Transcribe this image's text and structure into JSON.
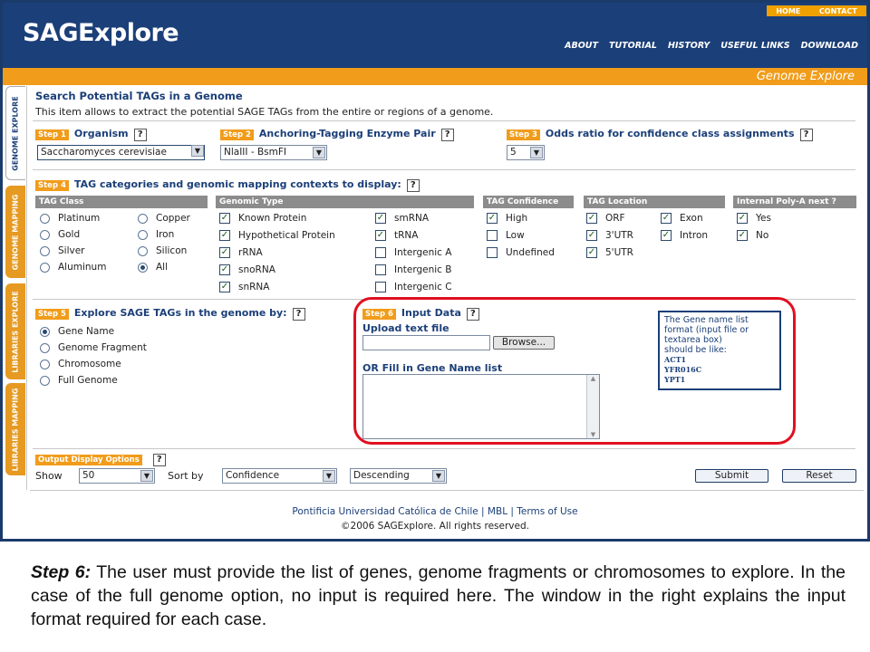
{
  "header": {
    "logo": "SAGExplore",
    "home": "HOME",
    "contact": "CONTACT",
    "nav": [
      "ABOUT",
      "TUTORIAL",
      "HISTORY",
      "USEFUL LINKS",
      "DOWNLOAD"
    ],
    "section": "Genome Explore"
  },
  "sidetabs": [
    "GENOME EXPLORE",
    "GENOME MAPPING",
    "LIBRARIES EXPLORE",
    "LIBRARIES MAPPING"
  ],
  "page": {
    "title": "Search Potential TAGs in a Genome",
    "intro": "This item allows to extract the potential SAGE TAGs from the entire or regions of a genome."
  },
  "step1": {
    "tag": "Step 1",
    "label": "Organism",
    "value": "Saccharomyces cerevisiae"
  },
  "step2": {
    "tag": "Step 2",
    "label": "Anchoring-Tagging Enzyme Pair",
    "value": "NlaIII - BsmFI"
  },
  "step3": {
    "tag": "Step 3",
    "label": "Odds ratio for confidence class assignments",
    "value": "5"
  },
  "help": "?",
  "step4": {
    "tag": "Step 4",
    "label": "TAG categories and genomic mapping contexts to display:",
    "tagclass": {
      "header": "TAG Class",
      "col1": [
        "Platinum",
        "Gold",
        "Silver",
        "Aluminum"
      ],
      "col2": [
        "Copper",
        "Iron",
        "Silicon",
        "All"
      ]
    },
    "genomic": {
      "header": "Genomic Type",
      "col1": [
        "Known Protein",
        "Hypothetical Protein",
        "rRNA",
        "snoRNA",
        "snRNA"
      ],
      "col2": [
        "smRNA",
        "tRNA",
        "Intergenic A",
        "Intergenic B",
        "Intergenic C"
      ]
    },
    "confidence": {
      "header": "TAG Confidence",
      "items": [
        "High",
        "Low",
        "Undefined"
      ]
    },
    "location": {
      "header": "TAG Location",
      "col1": [
        "ORF",
        "3'UTR",
        "5'UTR"
      ],
      "col2": [
        "Exon",
        "Intron"
      ]
    },
    "polya": {
      "header": "Internal Poly-A next ?",
      "items": [
        "Yes",
        "No"
      ]
    }
  },
  "step5": {
    "tag": "Step 5",
    "label": "Explore SAGE TAGs in the genome by:",
    "options": [
      "Gene Name",
      "Genome Fragment",
      "Chromosome",
      "Full Genome"
    ]
  },
  "step6": {
    "tag": "Step 6",
    "label": "Input Data",
    "upload": "Upload text file",
    "browse": "Browse...",
    "orfill": "OR Fill in Gene Name list",
    "note": {
      "l1": "The Gene name list",
      "l2": "format (input file or",
      "l3": "textarea box)",
      "l4": "should be like:",
      "g1": "ACT1",
      "g2": "YFR016C",
      "g3": "YPT1"
    }
  },
  "output": {
    "tag": "Output Display Options",
    "show_label": "Show",
    "show": "50",
    "sort_label": "Sort by",
    "sort": "Confidence",
    "order": "Descending",
    "submit": "Submit",
    "reset": "Reset"
  },
  "footer": {
    "line1": "Pontificia Universidad Católica de Chile  |  MBL  |  Terms of Use",
    "line2": "©2006 SAGExplore. All rights reserved."
  },
  "caption": {
    "lead": "Step 6:",
    "text": " The user must provide the list of genes, genome fragments or chromosomes to explore. In the case of the full genome option, no input is required here. The window in the right explains the input format required for each case."
  },
  "colors": {
    "brand": "#1b3f78",
    "accent": "#f19c1a",
    "highlight": "#e01020"
  }
}
